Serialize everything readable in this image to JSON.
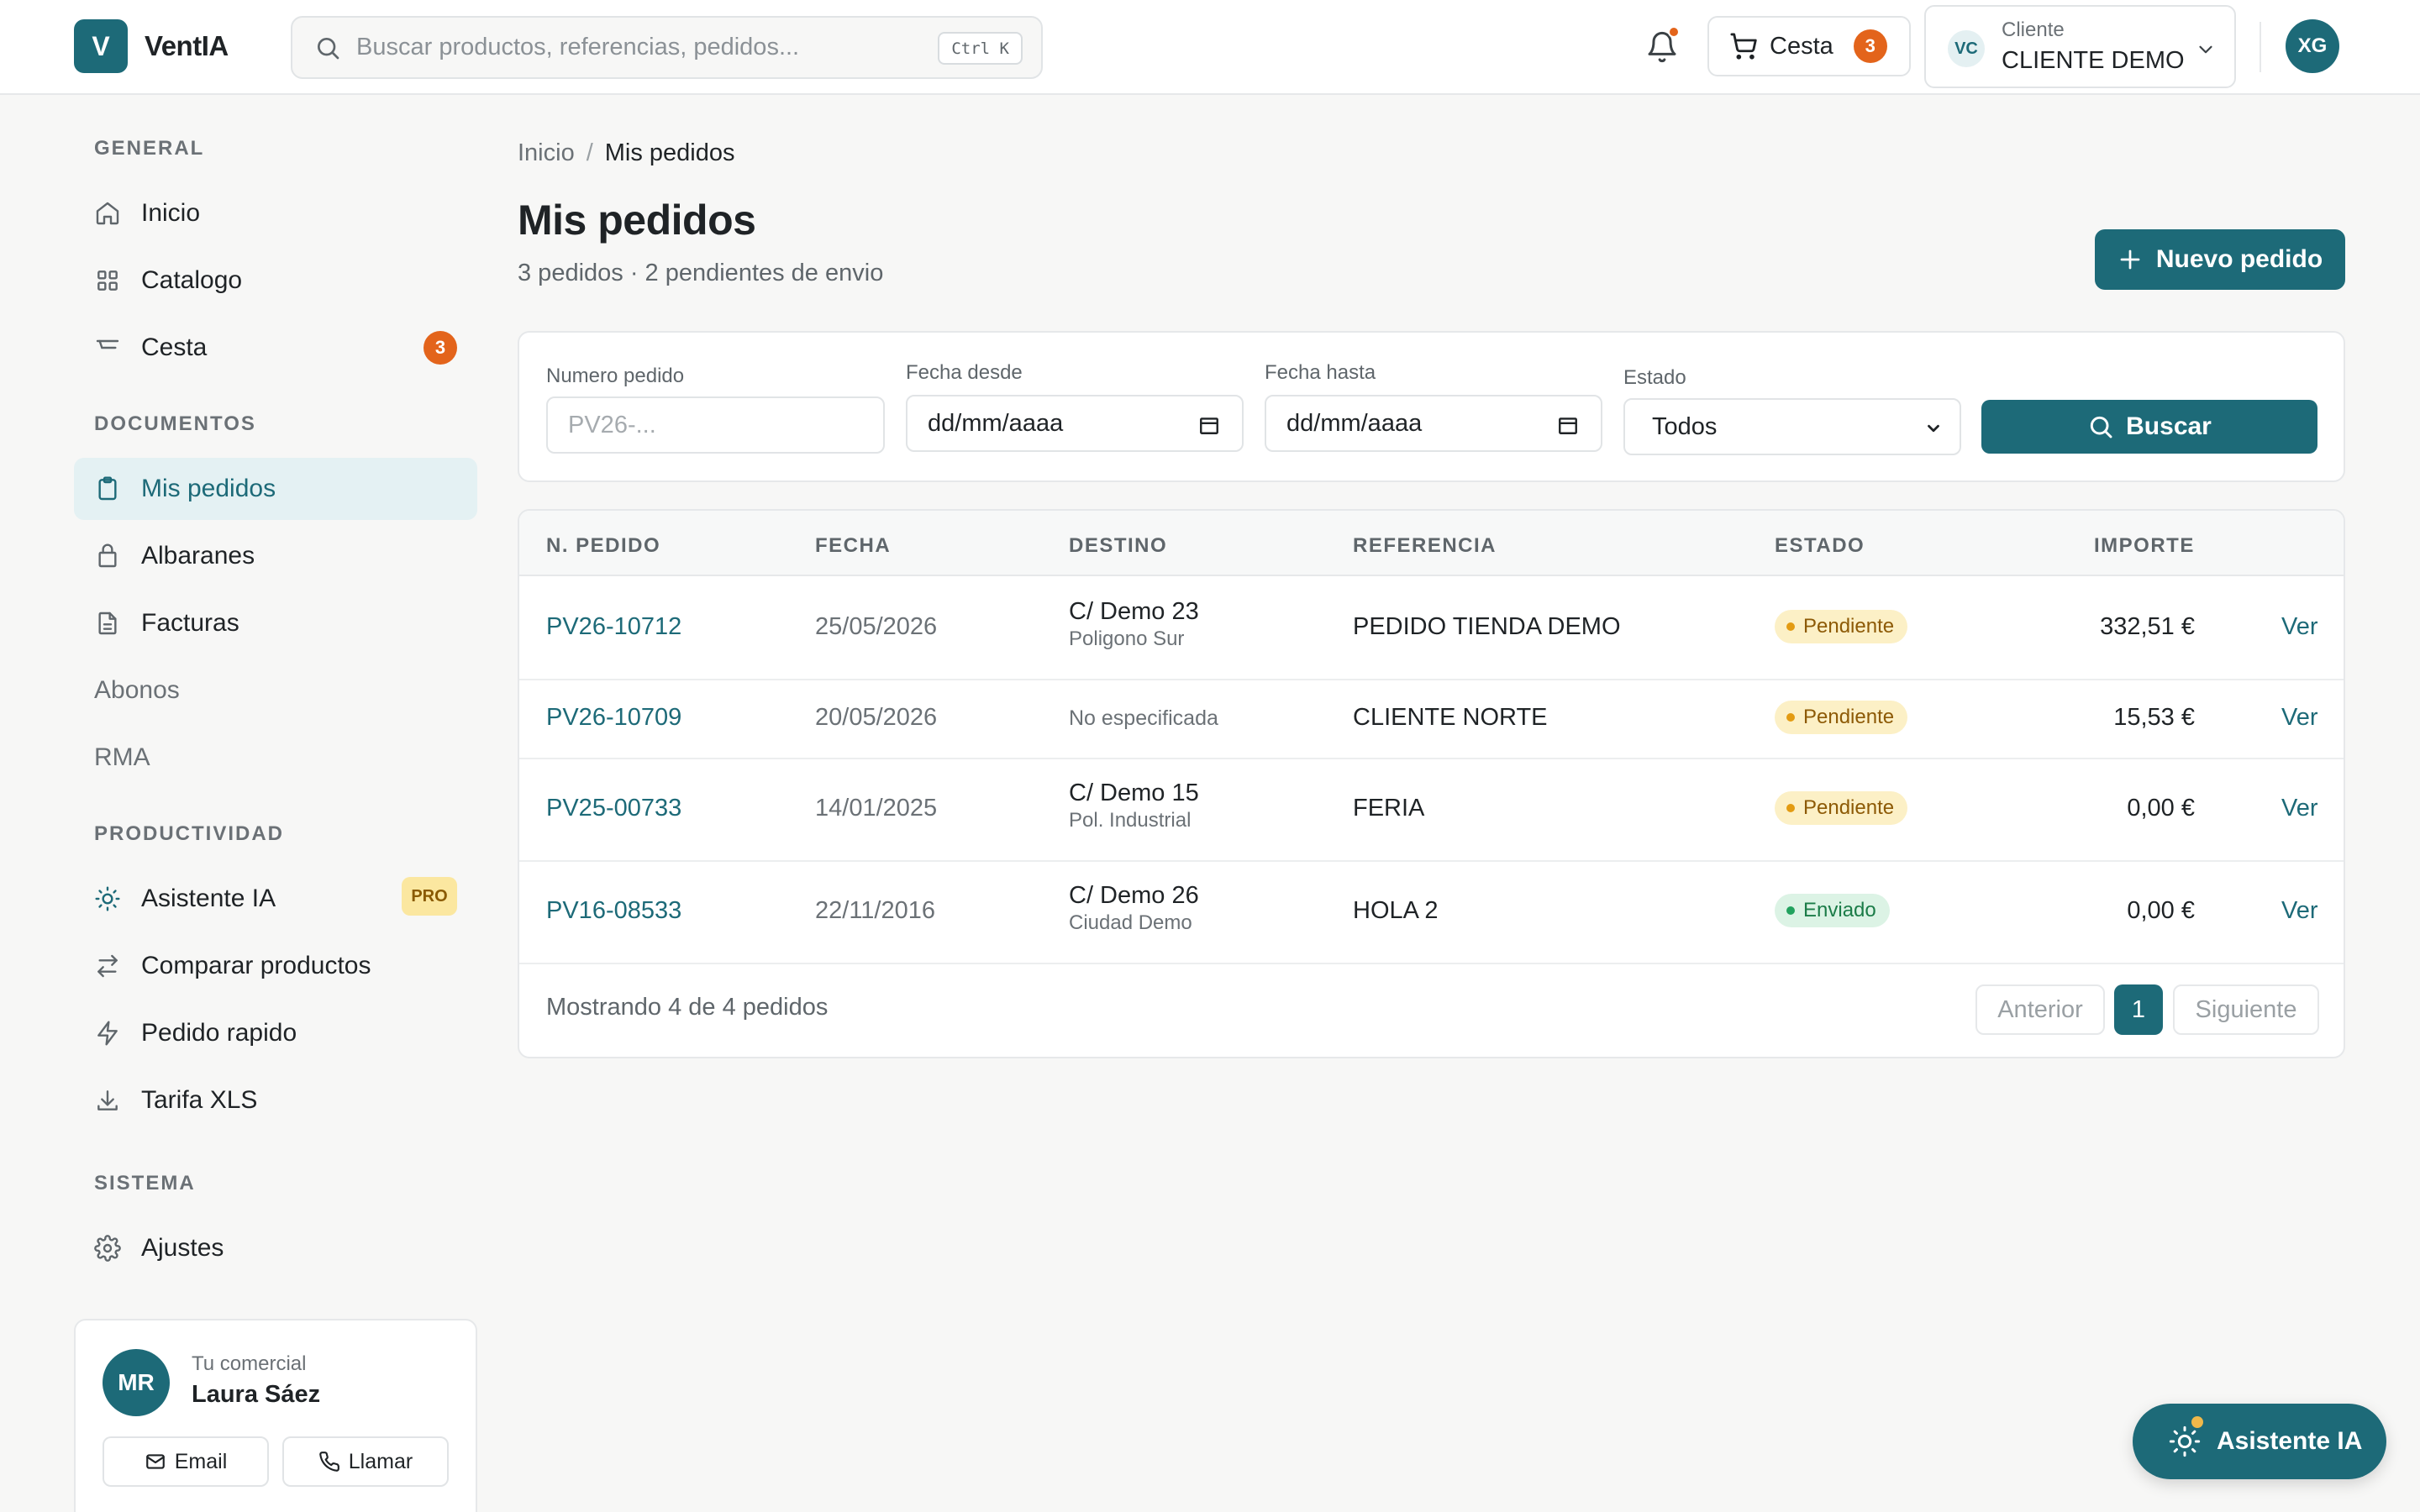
{
  "brand": {
    "logo_letter": "V",
    "name": "VentIA",
    "accent_color": "#1d6a78"
  },
  "header": {
    "search_placeholder": "Buscar productos, referencias, pedidos...",
    "search_shortcut": "Ctrl K",
    "cart_label": "Cesta",
    "cart_count": "3",
    "client_initials": "VC",
    "client_label": "Cliente",
    "client_name": "CLIENTE DEMO",
    "user_initials": "XG"
  },
  "sidebar": {
    "sections": {
      "general": "GENERAL",
      "documentos": "DOCUMENTOS",
      "productividad": "PRODUCTIVIDAD",
      "sistema": "SISTEMA"
    },
    "items": {
      "inicio": "Inicio",
      "catalogo": "Catalogo",
      "cesta": "Cesta",
      "cesta_badge": "3",
      "mis_pedidos": "Mis pedidos",
      "albaranes": "Albaranes",
      "facturas": "Facturas",
      "abonos": "Abonos",
      "rma": "RMA",
      "asistente_ia": "Asistente IA",
      "pro_badge": "PRO",
      "comparar": "Comparar productos",
      "pedido_rapido": "Pedido rapido",
      "tarifa": "Tarifa XLS",
      "ajustes": "Ajustes"
    },
    "rep": {
      "initials": "MR",
      "label": "Tu comercial",
      "name": "Laura Sáez",
      "email_label": "Email",
      "call_label": "Llamar"
    }
  },
  "main": {
    "breadcrumb": {
      "home": "Inicio",
      "separator": "/",
      "current": "Mis pedidos"
    },
    "title": "Mis pedidos",
    "subtitle": "3 pedidos · 2 pendientes de envio",
    "new_order_label": "Nuevo pedido",
    "filters": {
      "order_label": "Numero pedido",
      "order_placeholder": "PV26-...",
      "from_label": "Fecha desde",
      "from_value": "dd/mm/aaaa",
      "to_label": "Fecha hasta",
      "to_value": "dd/mm/aaaa",
      "status_label": "Estado",
      "status_value": "Todos",
      "search_label": "Buscar"
    },
    "table": {
      "headers": {
        "order": "N. PEDIDO",
        "date": "FECHA",
        "dest": "DESTINO",
        "ref": "REFERENCIA",
        "status": "ESTADO",
        "amount": "IMPORTE"
      },
      "rows": [
        {
          "order": "PV26-10712",
          "date": "25/05/2026",
          "dest_line1": "C/ Demo 23",
          "dest_line2": "Poligono Sur",
          "ref": "PEDIDO TIENDA DEMO",
          "status": "Pendiente",
          "amount": "332,51 €",
          "action": "Ver"
        },
        {
          "order": "PV26-10709",
          "date": "20/05/2026",
          "dest_line1": "No especificada",
          "dest_line2": "",
          "ref": "CLIENTE NORTE",
          "status": "Pendiente",
          "amount": "15,53 €",
          "action": "Ver"
        },
        {
          "order": "PV25-00733",
          "date": "14/01/2025",
          "dest_line1": "C/ Demo 15",
          "dest_line2": "Pol. Industrial",
          "ref": "FERIA",
          "status": "Pendiente",
          "amount": "0,00 €",
          "action": "Ver"
        },
        {
          "order": "PV16-08533",
          "date": "22/11/2016",
          "dest_line1": "C/ Demo 26",
          "dest_line2": "Ciudad Demo",
          "ref": "HOLA 2",
          "status": "Enviado",
          "amount": "0,00 €",
          "action": "Ver"
        }
      ],
      "footer_text": "Mostrando 4 de 4 pedidos",
      "prev_label": "Anterior",
      "page": "1",
      "next_label": "Siguiente"
    }
  },
  "assistant_fab": {
    "label": "Asistente IA"
  }
}
